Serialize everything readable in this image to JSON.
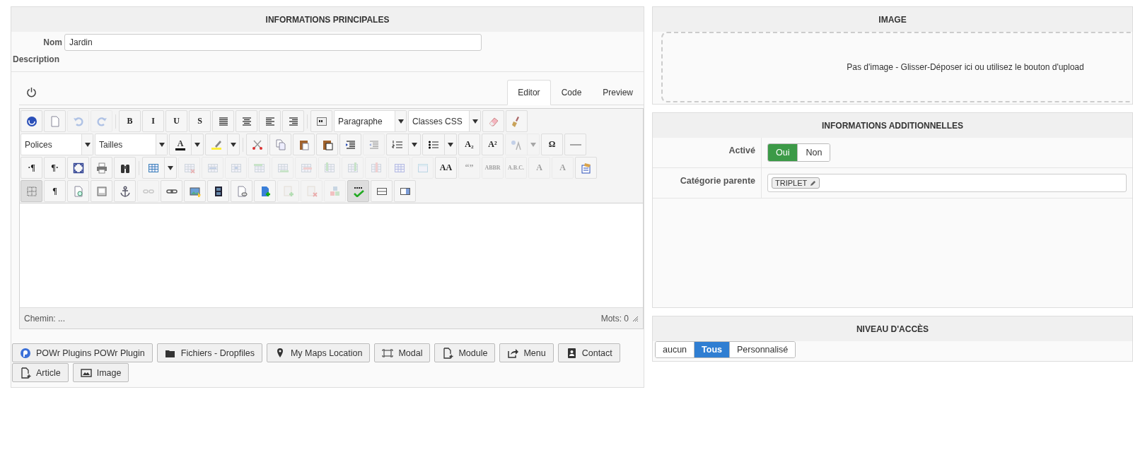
{
  "main": {
    "title": "INFORMATIONS PRINCIPALES",
    "name_label": "Nom",
    "name_value": "Jardin",
    "description_label": "Description",
    "editor": {
      "tabs": [
        {
          "label": "Editor",
          "selected": true
        },
        {
          "label": "Code",
          "selected": false
        },
        {
          "label": "Preview",
          "selected": false
        }
      ],
      "toolbar": [
        [
          {
            "kind": "icon",
            "disabled": false,
            "pressed": false
          },
          {
            "kind": "icon",
            "disabled": false,
            "pressed": false
          },
          {
            "kind": "icon",
            "disabled": true,
            "pressed": false
          },
          {
            "kind": "icon",
            "disabled": true,
            "pressed": false
          },
          {
            "kind": "sep"
          },
          {
            "kind": "glyph",
            "text": "B",
            "disabled": false,
            "pressed": false
          },
          {
            "kind": "glyph",
            "text": "I",
            "disabled": false,
            "pressed": false
          },
          {
            "kind": "glyph",
            "text": "U",
            "disabled": false,
            "pressed": false
          },
          {
            "kind": "glyph",
            "text": "S",
            "disabled": false,
            "pressed": false
          },
          {
            "kind": "icon",
            "disabled": false,
            "pressed": false
          },
          {
            "kind": "icon",
            "disabled": false,
            "pressed": false
          },
          {
            "kind": "icon",
            "disabled": false,
            "pressed": false
          },
          {
            "kind": "icon",
            "disabled": false,
            "pressed": false
          },
          {
            "kind": "sep"
          },
          {
            "kind": "icon",
            "disabled": false,
            "pressed": false
          },
          {
            "kind": "select",
            "value": "Paragraphe"
          },
          {
            "kind": "select",
            "value": "Classes CSS"
          },
          {
            "kind": "icon",
            "disabled": false,
            "pressed": false
          },
          {
            "kind": "icon",
            "disabled": false,
            "pressed": false
          }
        ],
        [
          {
            "kind": "select",
            "value": "Polices"
          },
          {
            "kind": "select",
            "value": "Tailles"
          },
          {
            "kind": "split",
            "text": "A",
            "disabled": false,
            "pressed": false
          },
          {
            "kind": "split",
            "disabled": false,
            "pressed": false
          },
          {
            "kind": "sep"
          },
          {
            "kind": "icon",
            "disabled": false,
            "pressed": false
          },
          {
            "kind": "icon",
            "disabled": false,
            "pressed": false
          },
          {
            "kind": "icon",
            "disabled": false,
            "pressed": false
          },
          {
            "kind": "icon",
            "disabled": false,
            "pressed": false
          },
          {
            "kind": "icon",
            "disabled": false,
            "pressed": false
          },
          {
            "kind": "icon",
            "disabled": true,
            "pressed": false
          },
          {
            "kind": "split",
            "disabled": false,
            "pressed": false
          },
          {
            "kind": "split",
            "disabled": false,
            "pressed": false
          },
          {
            "kind": "glyph",
            "text": "A₂",
            "disabled": false,
            "pressed": false
          },
          {
            "kind": "glyph",
            "text": "A²",
            "disabled": false,
            "pressed": false
          },
          {
            "kind": "split",
            "disabled": true,
            "pressed": false
          },
          {
            "kind": "glyph",
            "text": "Ω",
            "disabled": false,
            "pressed": false
          },
          {
            "kind": "icon",
            "disabled": false,
            "pressed": false
          }
        ],
        [
          {
            "kind": "glyph",
            "text": "·¶",
            "disabled": false,
            "pressed": false
          },
          {
            "kind": "glyph",
            "text": "¶·",
            "disabled": false,
            "pressed": false
          },
          {
            "kind": "icon",
            "disabled": false,
            "pressed": false
          },
          {
            "kind": "icon",
            "disabled": false,
            "pressed": false
          },
          {
            "kind": "icon",
            "disabled": false,
            "pressed": false
          },
          {
            "kind": "sep"
          },
          {
            "kind": "split",
            "disabled": false,
            "pressed": false
          },
          {
            "kind": "icon",
            "disabled": true,
            "pressed": false
          },
          {
            "kind": "icon",
            "disabled": true,
            "pressed": false
          },
          {
            "kind": "icon",
            "disabled": true,
            "pressed": false
          },
          {
            "kind": "icon",
            "disabled": true,
            "pressed": false
          },
          {
            "kind": "icon",
            "disabled": true,
            "pressed": false
          },
          {
            "kind": "icon",
            "disabled": true,
            "pressed": false
          },
          {
            "kind": "icon",
            "disabled": true,
            "pressed": false
          },
          {
            "kind": "icon",
            "disabled": true,
            "pressed": false
          },
          {
            "kind": "icon",
            "disabled": true,
            "pressed": false
          },
          {
            "kind": "icon",
            "disabled": true,
            "pressed": false
          },
          {
            "kind": "icon",
            "disabled": true,
            "pressed": false
          },
          {
            "kind": "glyph",
            "text": "AA",
            "disabled": false,
            "pressed": false
          },
          {
            "kind": "glyph",
            "text": "“”",
            "disabled": true,
            "pressed": false
          },
          {
            "kind": "glyph",
            "text": "ABBR",
            "disabled": true,
            "pressed": false
          },
          {
            "kind": "glyph",
            "text": "A.B.C.",
            "disabled": true,
            "pressed": false
          },
          {
            "kind": "glyph",
            "text": "A",
            "disabled": true,
            "pressed": false
          },
          {
            "kind": "glyph",
            "text": "A",
            "disabled": true,
            "pressed": false
          },
          {
            "kind": "icon",
            "disabled": false,
            "pressed": false
          }
        ],
        [
          {
            "kind": "icon",
            "disabled": false,
            "pressed": true
          },
          {
            "kind": "glyph",
            "text": "¶",
            "disabled": false,
            "pressed": false
          },
          {
            "kind": "icon",
            "disabled": false,
            "pressed": false
          },
          {
            "kind": "icon",
            "disabled": false,
            "pressed": false
          },
          {
            "kind": "icon",
            "disabled": false,
            "pressed": false
          },
          {
            "kind": "icon",
            "disabled": true,
            "pressed": false
          },
          {
            "kind": "icon",
            "disabled": false,
            "pressed": false
          },
          {
            "kind": "icon",
            "disabled": false,
            "pressed": false
          },
          {
            "kind": "icon",
            "disabled": false,
            "pressed": false
          },
          {
            "kind": "icon",
            "disabled": false,
            "pressed": false
          },
          {
            "kind": "icon",
            "disabled": false,
            "pressed": false
          },
          {
            "kind": "icon",
            "disabled": true,
            "pressed": false
          },
          {
            "kind": "icon",
            "disabled": true,
            "pressed": false
          },
          {
            "kind": "icon",
            "disabled": true,
            "pressed": false
          },
          {
            "kind": "icon",
            "disabled": false,
            "pressed": true
          },
          {
            "kind": "icon",
            "disabled": false,
            "pressed": false
          },
          {
            "kind": "icon",
            "disabled": false,
            "pressed": false
          }
        ]
      ],
      "path": "Chemin: ...",
      "words": "Mots: 0"
    },
    "buttons": [
      {
        "label": "POWr Plugins POWr Plugin"
      },
      {
        "label": "Fichiers - Dropfiles"
      },
      {
        "label": "My Maps Location"
      },
      {
        "label": "Modal"
      },
      {
        "label": "Module"
      },
      {
        "label": "Menu"
      },
      {
        "label": "Contact"
      },
      {
        "label": "Article"
      },
      {
        "label": "Image"
      }
    ]
  },
  "image": {
    "title": "IMAGE",
    "dropzone": "Pas d'image - Glisser-Déposer ici ou utilisez le bouton d'upload"
  },
  "additional": {
    "title": "INFORMATIONS ADDITIONNELLES",
    "rows": [
      {
        "kind": "toggle",
        "label": "Activé",
        "options": [
          {
            "label": "Oui",
            "selected": true
          },
          {
            "label": "Non",
            "selected": false
          }
        ]
      },
      {
        "kind": "tags",
        "label": "Catégorie parente",
        "tags": [
          "TRIPLET"
        ]
      }
    ]
  },
  "access": {
    "title": "NIVEAU D'ACCÈS",
    "options": [
      {
        "label": "aucun",
        "selected": false
      },
      {
        "label": "Tous",
        "selected": true
      },
      {
        "label": "Personnalisé",
        "selected": false
      }
    ]
  }
}
